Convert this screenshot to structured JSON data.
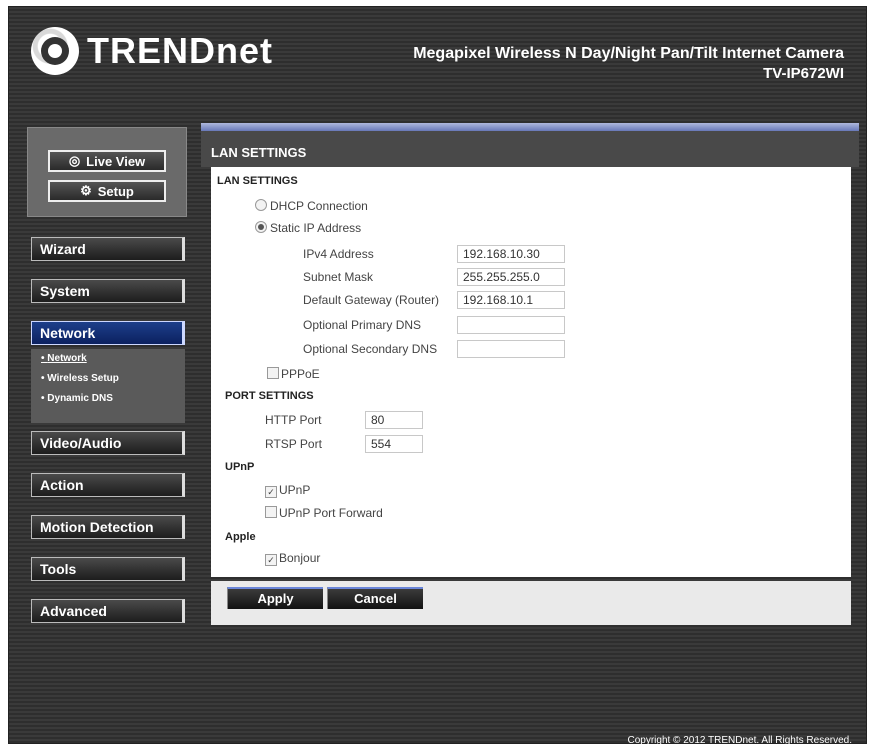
{
  "header": {
    "brand": "TRENDnet",
    "product_name": "Megapixel Wireless N Day/Night Pan/Tilt Internet Camera",
    "model": "TV-IP672WI"
  },
  "quick": {
    "live_view": "Live View",
    "setup": "Setup"
  },
  "nav": {
    "wizard": "Wizard",
    "system": "System",
    "network": "Network",
    "video_audio": "Video/Audio",
    "action": "Action",
    "motion_detection": "Motion Detection",
    "tools": "Tools",
    "advanced": "Advanced"
  },
  "subnav": {
    "network": "Network",
    "wireless": "Wireless Setup",
    "ddns": "Dynamic DNS"
  },
  "page": {
    "title": "LAN SETTINGS",
    "lan_section": "LAN SETTINGS",
    "dhcp": "DHCP Connection",
    "static": "Static IP Address",
    "ipv4_label": "IPv4 Address",
    "ipv4_value": "192.168.10.30",
    "subnet_label": "Subnet Mask",
    "subnet_value": "255.255.255.0",
    "gateway_label": "Default Gateway (Router)",
    "gateway_value": "192.168.10.1",
    "dns1_label": "Optional Primary DNS",
    "dns1_value": "",
    "dns2_label": "Optional Secondary DNS",
    "dns2_value": "",
    "pppoe": "PPPoE",
    "port_section": "PORT SETTINGS",
    "http_label": "HTTP Port",
    "http_value": "80",
    "rtsp_label": "RTSP Port",
    "rtsp_value": "554",
    "upnp_section": "UPnP",
    "upnp": "UPnP",
    "upnp_forward": "UPnP Port Forward",
    "apple_section": "Apple",
    "bonjour": "Bonjour"
  },
  "buttons": {
    "apply": "Apply",
    "cancel": "Cancel"
  },
  "footer": {
    "copyright": "Copyright © 2012 TRENDnet. All Rights Reserved."
  },
  "state": {
    "ip_mode": "static",
    "pppoe_checked": false,
    "upnp_checked": true,
    "upnp_forward_checked": false,
    "bonjour_checked": true
  }
}
